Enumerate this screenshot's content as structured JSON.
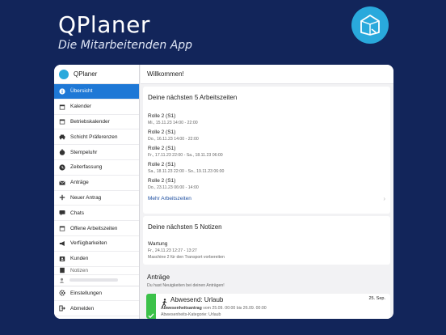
{
  "promo": {
    "title": "QPlaner",
    "subtitle": "Die Mitarbeitenden App"
  },
  "colors": {
    "background": "#12255a",
    "brand": "#29a9dc",
    "active": "#1e78d6",
    "success": "#3cc24a",
    "link": "#1e4fa0"
  },
  "sidebar": {
    "app_name": "QPlaner",
    "items": [
      {
        "label": "Übersicht",
        "icon": "info-icon",
        "active": true
      },
      {
        "label": "Kalender",
        "icon": "calendar-icon",
        "active": false
      },
      {
        "label": "Betriebskalender",
        "icon": "calendar-icon",
        "active": false
      },
      {
        "label": "Schicht Präferenzen",
        "icon": "car-icon",
        "active": false
      },
      {
        "label": "Stempeluhr",
        "icon": "stopwatch-icon",
        "active": false
      },
      {
        "label": "Zeiterfassung",
        "icon": "clock-icon",
        "active": false
      },
      {
        "label": "Anträge",
        "icon": "envelope-icon",
        "active": false
      },
      {
        "label": "Neuer Antrag",
        "icon": "plus-icon",
        "active": false
      },
      {
        "label": "Chats",
        "icon": "chat-icon",
        "active": false
      },
      {
        "label": "Offene Arbeitszeiten",
        "icon": "calendar-icon",
        "active": false
      },
      {
        "label": "Verfügbarkeiten",
        "icon": "megaphone-icon",
        "active": false
      },
      {
        "label": "Kunden",
        "icon": "contact-icon",
        "active": false
      },
      {
        "label": "Notizen",
        "icon": "note-icon",
        "active": false
      }
    ],
    "bottom_items": [
      {
        "label": "Einstellungen",
        "icon": "gear-icon"
      },
      {
        "label": "Abmelden",
        "icon": "logout-icon"
      }
    ]
  },
  "header": {
    "title": "Willkommen!"
  },
  "shifts_card": {
    "title": "Deine nächsten 5 Arbeitszeiten",
    "items": [
      {
        "role": "Rolle 2 (S1)",
        "time": "Mi., 15.11.23 14:00 - 22:00"
      },
      {
        "role": "Rolle 2 (S1)",
        "time": "Do., 16.11.23 14:00 - 22:00"
      },
      {
        "role": "Rolle 2 (S1)",
        "time": "Fr., 17.11.23 22:00 - Sa., 18.11.23 06:00"
      },
      {
        "role": "Rolle 2 (S1)",
        "time": "Sa., 18.11.23 22:00 - So., 19.11.23 06:00"
      },
      {
        "role": "Rolle 2 (S1)",
        "time": "Do., 23.11.23 06:00 - 14:00"
      }
    ],
    "more_label": "Mehr Arbeitszeiten"
  },
  "notes_card": {
    "title": "Deine nächsten 5 Notizen",
    "items": [
      {
        "title": "Wartung",
        "time": "Fr., 24.11.23 12:27 - 13:27",
        "text": "Maschine 2 für den Transport vorbereiten"
      }
    ]
  },
  "requests": {
    "title": "Anträge",
    "subtitle": "Du hast Neuigkeiten bei deinen Anträgen!",
    "items": [
      {
        "title": "Abwesend: Urlaub",
        "date": "25. Sep.",
        "line1_bold": "Abwesenheitsantrag",
        "line1_rest": "vom 25.09. 00:00 bis 26.09. 00:00",
        "line2": "Abwesenheits-Kategorie: Urlaub"
      }
    ]
  }
}
